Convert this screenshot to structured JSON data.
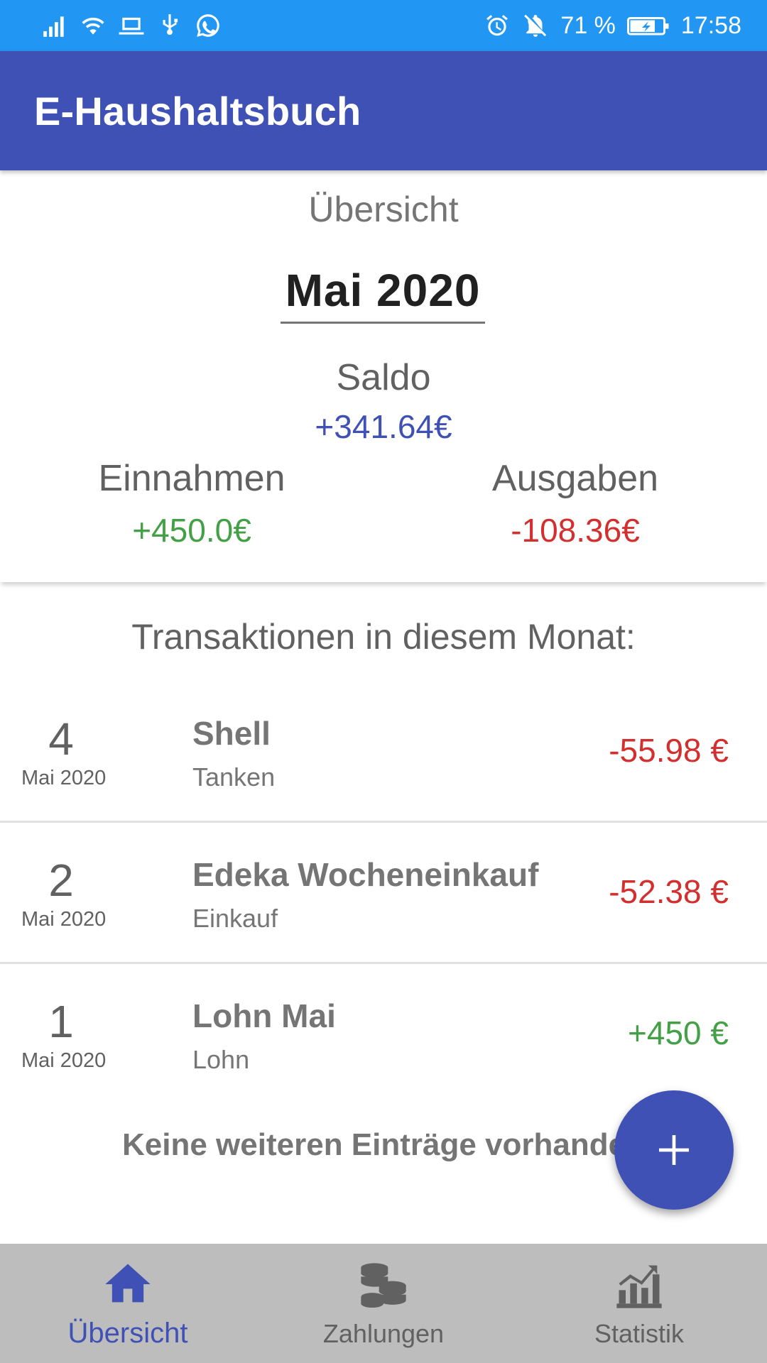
{
  "status_bar": {
    "battery": "71 %",
    "time": "17:58",
    "icons_left": [
      "signal-icon",
      "wifi-icon",
      "laptop-icon",
      "usb-icon",
      "whatsapp-icon"
    ],
    "icons_right": [
      "alarm-icon",
      "mute-icon",
      "battery-icon"
    ]
  },
  "app_bar": {
    "title": "E-Haushaltsbuch"
  },
  "overview": {
    "heading": "Übersicht",
    "month": "Mai 2020",
    "saldo_label": "Saldo",
    "saldo_value": "+341.64€",
    "income_label": "Einnahmen",
    "income_value": "+450.0€",
    "expense_label": "Ausgaben",
    "expense_value": "-108.36€"
  },
  "transactions": {
    "heading": "Transaktionen in diesem Monat:",
    "items": [
      {
        "day": "4",
        "month": "Mai 2020",
        "title": "Shell",
        "category": "Tanken",
        "amount": "-55.98 €",
        "type": "expense"
      },
      {
        "day": "2",
        "month": "Mai 2020",
        "title": "Edeka Wocheneinkauf",
        "category": "Einkauf",
        "amount": "-52.38 €",
        "type": "expense"
      },
      {
        "day": "1",
        "month": "Mai 2020",
        "title": "Lohn Mai",
        "category": "Lohn",
        "amount": "+450 €",
        "type": "income"
      }
    ],
    "empty_note": "Keine weiteren Einträge vorhanden"
  },
  "fab": {
    "icon": "plus-icon"
  },
  "bottom_nav": {
    "items": [
      {
        "label": "Übersicht",
        "icon": "home-icon",
        "active": true
      },
      {
        "label": "Zahlungen",
        "icon": "coins-icon",
        "active": false
      },
      {
        "label": "Statistik",
        "icon": "chart-icon",
        "active": false
      }
    ]
  },
  "colors": {
    "status_bar": "#2196f3",
    "app_bar": "#3f51b5",
    "income": "#43a047",
    "expense": "#d32f2f",
    "nav_background": "#bdbdbd"
  }
}
